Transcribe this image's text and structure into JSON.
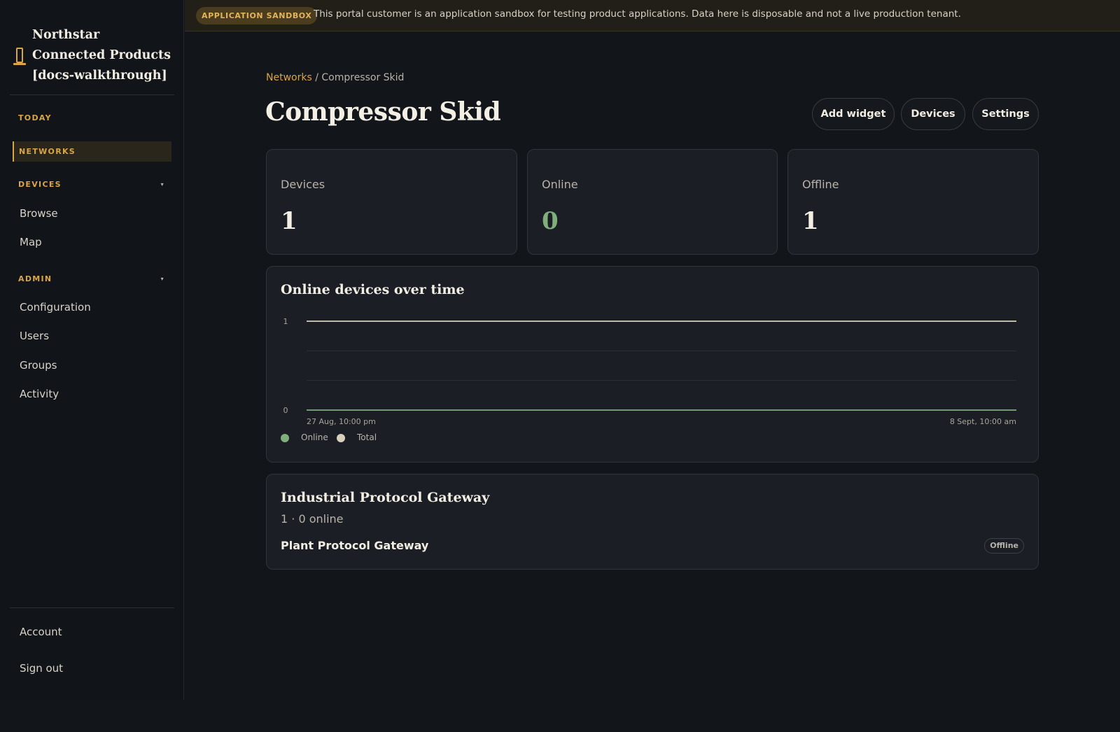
{
  "sidebar": {
    "brand_name": "Northstar Connected Products [docs-walkthrough]",
    "sections": {
      "today": "TODAY",
      "networks": "NETWORKS",
      "devices": "DEVICES",
      "admin": "ADMIN"
    },
    "devices_items": [
      "Browse",
      "Map"
    ],
    "admin_items": [
      "Configuration",
      "Users",
      "Groups",
      "Activity"
    ],
    "footer_items": [
      "Account",
      "Sign out"
    ],
    "caret_glyph": "▾"
  },
  "banner": {
    "badge": "APPLICATION SANDBOX",
    "text": "This portal customer is an application sandbox for testing product applications. Data here is disposable and not a live production tenant."
  },
  "breadcrumb": {
    "parent": "Networks",
    "separator": " / ",
    "current": "Compressor Skid"
  },
  "page_title": "Compressor Skid",
  "actions": {
    "add_widget": "Add widget",
    "devices": "Devices",
    "settings": "Settings"
  },
  "stats": [
    {
      "label": "Devices",
      "value": "1"
    },
    {
      "label": "Online",
      "value": "0"
    },
    {
      "label": "Offline",
      "value": "1"
    }
  ],
  "chart": {
    "title": "Online devices over time",
    "chart_data": {
      "type": "line",
      "x_labels": [
        "27 Aug, 10:00 pm",
        "8 Sept, 10:00 am"
      ],
      "y_ticks": [
        "1",
        "0"
      ],
      "ylim": [
        0,
        1
      ],
      "grid": true,
      "legend_placement": "bottom-left",
      "series": [
        {
          "name": "Online",
          "color": "#7faf7a",
          "values": [
            0,
            0
          ]
        },
        {
          "name": "Total",
          "color": "#d8d0bc",
          "values": [
            1,
            1
          ]
        }
      ]
    }
  },
  "gateway": {
    "title": "Industrial Protocol Gateway",
    "summary": "1 · 0 online",
    "device_name": "Plant Protocol Gateway",
    "status": "Offline"
  },
  "colors": {
    "accent": "#d9a545",
    "online": "#7faf7a",
    "background": "#121519"
  }
}
